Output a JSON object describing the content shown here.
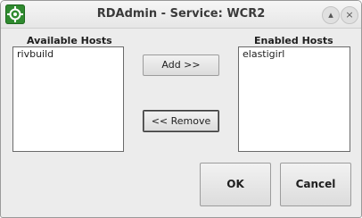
{
  "window": {
    "title": "RDAdmin - Service: WCR2",
    "buttons": [
      "▴",
      "×"
    ]
  },
  "available": {
    "label": "Available Hosts",
    "items": [
      "rivbuild"
    ]
  },
  "enabled": {
    "label": "Enabled Hosts",
    "items": [
      "elastigirl"
    ]
  },
  "actions": {
    "add_label": "Add >>",
    "remove_label": "<< Remove"
  },
  "dialog": {
    "ok_label": "OK",
    "cancel_label": "Cancel"
  }
}
